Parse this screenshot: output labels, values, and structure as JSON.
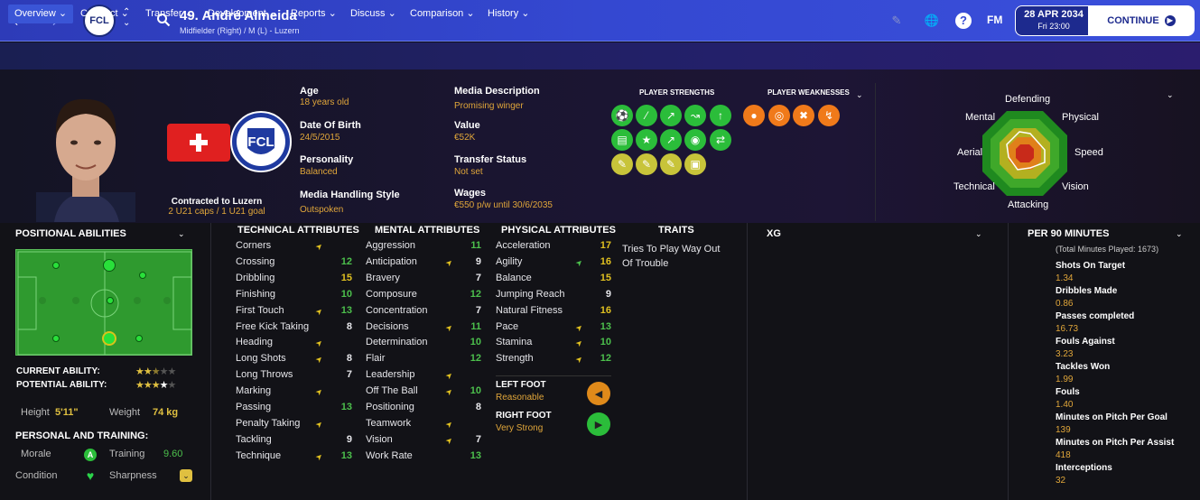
{
  "header": {
    "player_title": "49. André Almeida",
    "player_subtitle": "Midfielder (Right) / M (L) - Luzern",
    "club_short": "FCL",
    "fm_logo": "FM",
    "date": "28 APR 2034",
    "day_time": "Fri 23:00",
    "continue_label": "CONTINUE"
  },
  "tabs": [
    {
      "label": "Overview"
    },
    {
      "label": "Contract"
    },
    {
      "label": "Transfer"
    },
    {
      "label": "Development"
    },
    {
      "label": "Reports"
    },
    {
      "label": "Discuss"
    },
    {
      "label": "Comparison"
    },
    {
      "label": "History"
    }
  ],
  "contract": {
    "line1": "Contracted to Luzern",
    "line2": "2 U21 caps / 1 U21 goal"
  },
  "info": {
    "age_label": "Age",
    "age": "18 years old",
    "dob_label": "Date Of Birth",
    "dob": "24/5/2015",
    "personality_label": "Personality",
    "personality": "Balanced",
    "media_style_label": "Media Handling Style",
    "media_style": "Outspoken",
    "media_desc_label": "Media Description",
    "media_desc": "Promising winger",
    "value_label": "Value",
    "value": "€52K",
    "transfer_label": "Transfer Status",
    "transfer": "Not set",
    "wages_label": "Wages",
    "wages": "€550 p/w until 30/6/2035"
  },
  "strengths_title": "PLAYER STRENGTHS",
  "weaknesses_title": "PLAYER WEAKNESSES",
  "radar": {
    "labels": {
      "defending": "Defending",
      "physical": "Physical",
      "speed": "Speed",
      "vision": "Vision",
      "attacking": "Attacking",
      "technical": "Technical",
      "aerial": "Aerial",
      "mental": "Mental"
    }
  },
  "positional": {
    "title": "POSITIONAL ABILITIES",
    "current_label": "CURRENT ABILITY:",
    "potential_label": "POTENTIAL ABILITY:",
    "current_stars": 2.5,
    "potential_stars": 3.5,
    "height_label": "Height",
    "height": "5'11\"",
    "weight_label": "Weight",
    "weight": "74 kg",
    "personal_title": "PERSONAL AND TRAINING:",
    "morale_label": "Morale",
    "morale_grade": "A",
    "training_label": "Training",
    "training": "9.60",
    "condition_label": "Condition",
    "sharpness_label": "Sharpness"
  },
  "technical": {
    "title": "TECHNICAL ATTRIBUTES",
    "rows": [
      {
        "name": "Corners",
        "value": "",
        "arrow": "up"
      },
      {
        "name": "Crossing",
        "value": "12",
        "color": "green"
      },
      {
        "name": "Dribbling",
        "value": "15",
        "color": "yellow"
      },
      {
        "name": "Finishing",
        "value": "10",
        "color": "green"
      },
      {
        "name": "First Touch",
        "value": "13",
        "color": "green",
        "arrow": "up"
      },
      {
        "name": "Free Kick Taking",
        "value": "8",
        "color": "white"
      },
      {
        "name": "Heading",
        "value": "",
        "arrow": "up"
      },
      {
        "name": "Long Shots",
        "value": "8",
        "color": "white",
        "arrow": "up"
      },
      {
        "name": "Long Throws",
        "value": "7",
        "color": "white"
      },
      {
        "name": "Marking",
        "value": "",
        "arrow": "up"
      },
      {
        "name": "Passing",
        "value": "13",
        "color": "green"
      },
      {
        "name": "Penalty Taking",
        "value": "",
        "arrow": "up"
      },
      {
        "name": "Tackling",
        "value": "9",
        "color": "white"
      },
      {
        "name": "Technique",
        "value": "13",
        "color": "green",
        "arrow": "up"
      }
    ]
  },
  "mental": {
    "title": "MENTAL ATTRIBUTES",
    "rows": [
      {
        "name": "Aggression",
        "value": "11",
        "color": "green"
      },
      {
        "name": "Anticipation",
        "value": "9",
        "color": "white",
        "arrow": "up"
      },
      {
        "name": "Bravery",
        "value": "7",
        "color": "white"
      },
      {
        "name": "Composure",
        "value": "12",
        "color": "green"
      },
      {
        "name": "Concentration",
        "value": "7",
        "color": "white"
      },
      {
        "name": "Decisions",
        "value": "11",
        "color": "green",
        "arrow": "up"
      },
      {
        "name": "Determination",
        "value": "10",
        "color": "green"
      },
      {
        "name": "Flair",
        "value": "12",
        "color": "green"
      },
      {
        "name": "Leadership",
        "value": "",
        "arrow": "up"
      },
      {
        "name": "Off The Ball",
        "value": "10",
        "color": "green",
        "arrow": "up"
      },
      {
        "name": "Positioning",
        "value": "8",
        "color": "white"
      },
      {
        "name": "Teamwork",
        "value": "",
        "arrow": "up"
      },
      {
        "name": "Vision",
        "value": "7",
        "color": "white",
        "arrow": "up"
      },
      {
        "name": "Work Rate",
        "value": "13",
        "color": "green"
      }
    ]
  },
  "physical": {
    "title": "PHYSICAL ATTRIBUTES",
    "rows": [
      {
        "name": "Acceleration",
        "value": "17",
        "color": "yellow"
      },
      {
        "name": "Agility",
        "value": "16",
        "color": "yellow",
        "arrow": "green"
      },
      {
        "name": "Balance",
        "value": "15",
        "color": "yellow"
      },
      {
        "name": "Jumping Reach",
        "value": "9",
        "color": "white"
      },
      {
        "name": "Natural Fitness",
        "value": "16",
        "color": "yellow"
      },
      {
        "name": "Pace",
        "value": "13",
        "color": "green",
        "arrow": "up"
      },
      {
        "name": "Stamina",
        "value": "10",
        "color": "green",
        "arrow": "up"
      },
      {
        "name": "Strength",
        "value": "12",
        "color": "green",
        "arrow": "up"
      }
    ],
    "left_foot_label": "LEFT FOOT",
    "left_foot": "Reasonable",
    "right_foot_label": "RIGHT FOOT",
    "right_foot": "Very Strong"
  },
  "traits": {
    "title": "TRAITS",
    "text": "Tries To Play Way Out Of Trouble"
  },
  "xg": {
    "title": "XG"
  },
  "per90": {
    "title": "PER 90 MINUTES",
    "subtitle": "(Total Minutes Played: 1673)",
    "stats": [
      {
        "label": "Shots On Target",
        "value": "1.34"
      },
      {
        "label": "Dribbles Made",
        "value": "0.86"
      },
      {
        "label": "Passes completed",
        "value": "16.73"
      },
      {
        "label": "Fouls Against",
        "value": "3.23"
      },
      {
        "label": "Tackles Won",
        "value": "1.99"
      },
      {
        "label": "Fouls",
        "value": "1.40"
      },
      {
        "label": "Minutes on Pitch Per Goal",
        "value": "139"
      },
      {
        "label": "Minutes on Pitch Per Assist",
        "value": "418"
      },
      {
        "label": "Interceptions",
        "value": "32"
      }
    ]
  },
  "colors": {
    "accent": "#3a55d6",
    "good": "#4cc04c",
    "great": "#e0c020",
    "orange": "#e0a63a"
  }
}
